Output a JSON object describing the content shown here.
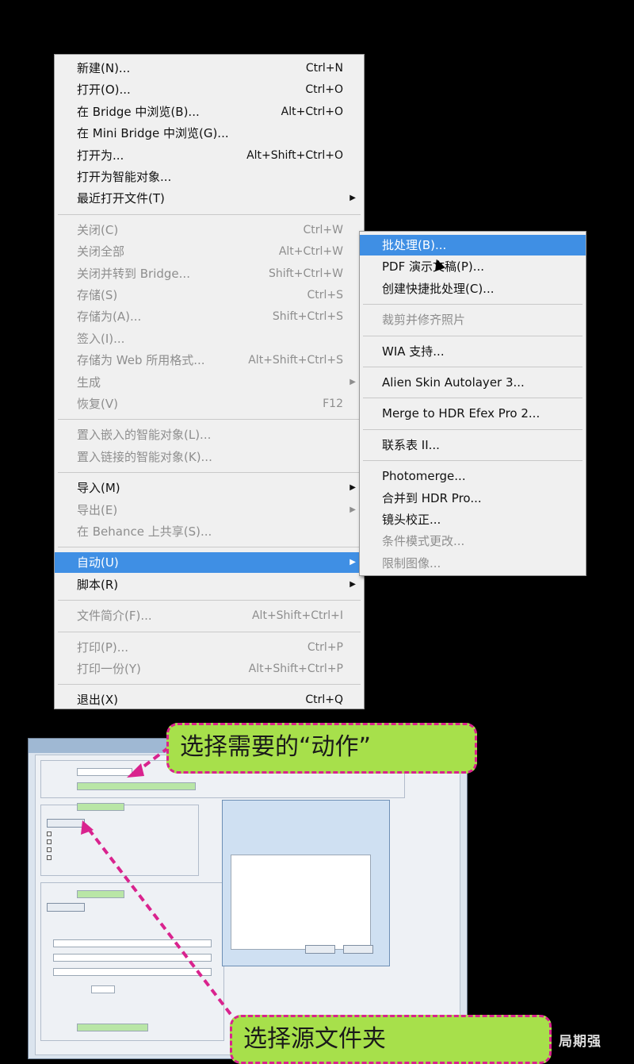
{
  "file_menu": {
    "groups": [
      [
        {
          "label": "新建(N)...",
          "shortcut": "Ctrl+N",
          "disabled": false
        },
        {
          "label": "打开(O)...",
          "shortcut": "Ctrl+O",
          "disabled": false
        },
        {
          "label": "在 Bridge 中浏览(B)...",
          "shortcut": "Alt+Ctrl+O",
          "disabled": false
        },
        {
          "label": "在 Mini Bridge 中浏览(G)...",
          "shortcut": "",
          "disabled": false
        },
        {
          "label": "打开为...",
          "shortcut": "Alt+Shift+Ctrl+O",
          "disabled": false
        },
        {
          "label": "打开为智能对象...",
          "shortcut": "",
          "disabled": false
        },
        {
          "label": "最近打开文件(T)",
          "shortcut": "",
          "disabled": false,
          "submenu": true
        }
      ],
      [
        {
          "label": "关闭(C)",
          "shortcut": "Ctrl+W",
          "disabled": true
        },
        {
          "label": "关闭全部",
          "shortcut": "Alt+Ctrl+W",
          "disabled": true
        },
        {
          "label": "关闭并转到 Bridge...",
          "shortcut": "Shift+Ctrl+W",
          "disabled": true
        },
        {
          "label": "存储(S)",
          "shortcut": "Ctrl+S",
          "disabled": true
        },
        {
          "label": "存储为(A)...",
          "shortcut": "Shift+Ctrl+S",
          "disabled": true
        },
        {
          "label": "签入(I)...",
          "shortcut": "",
          "disabled": true
        },
        {
          "label": "存储为 Web 所用格式...",
          "shortcut": "Alt+Shift+Ctrl+S",
          "disabled": true
        },
        {
          "label": "生成",
          "shortcut": "",
          "disabled": true,
          "submenu": true
        },
        {
          "label": "恢复(V)",
          "shortcut": "F12",
          "disabled": true
        }
      ],
      [
        {
          "label": "置入嵌入的智能对象(L)...",
          "shortcut": "",
          "disabled": true
        },
        {
          "label": "置入链接的智能对象(K)...",
          "shortcut": "",
          "disabled": true
        }
      ],
      [
        {
          "label": "导入(M)",
          "shortcut": "",
          "disabled": false,
          "submenu": true
        },
        {
          "label": "导出(E)",
          "shortcut": "",
          "disabled": true,
          "submenu": true
        },
        {
          "label": "在 Behance 上共享(S)...",
          "shortcut": "",
          "disabled": true
        }
      ],
      [
        {
          "label": "自动(U)",
          "shortcut": "",
          "disabled": false,
          "submenu": true,
          "highlighted": true
        },
        {
          "label": "脚本(R)",
          "shortcut": "",
          "disabled": false,
          "submenu": true
        }
      ],
      [
        {
          "label": "文件简介(F)...",
          "shortcut": "Alt+Shift+Ctrl+I",
          "disabled": true
        }
      ],
      [
        {
          "label": "打印(P)...",
          "shortcut": "Ctrl+P",
          "disabled": true
        },
        {
          "label": "打印一份(Y)",
          "shortcut": "Alt+Shift+Ctrl+P",
          "disabled": true
        }
      ],
      [
        {
          "label": "退出(X)",
          "shortcut": "Ctrl+Q",
          "disabled": false
        }
      ]
    ]
  },
  "automate_submenu": {
    "groups": [
      [
        {
          "label": "批处理(B)...",
          "disabled": false,
          "highlighted": true
        },
        {
          "label": "PDF 演示文稿(P)...",
          "disabled": false
        },
        {
          "label": "创建快捷批处理(C)...",
          "disabled": false
        }
      ],
      [
        {
          "label": "裁剪并修齐照片",
          "disabled": true
        }
      ],
      [
        {
          "label": "WIA 支持...",
          "disabled": false
        }
      ],
      [
        {
          "label": "Alien Skin Autolayer 3...",
          "disabled": false
        }
      ],
      [
        {
          "label": "Merge to HDR Efex Pro 2...",
          "disabled": false
        }
      ],
      [
        {
          "label": "联系表 II...",
          "disabled": false
        }
      ],
      [
        {
          "label": "Photomerge...",
          "disabled": false
        },
        {
          "label": "合并到 HDR Pro...",
          "disabled": false
        },
        {
          "label": "镜头校正...",
          "disabled": false
        },
        {
          "label": "条件模式更改...",
          "disabled": true
        },
        {
          "label": "限制图像...",
          "disabled": true
        }
      ]
    ]
  },
  "callouts": {
    "action": "选择需要的“动作”",
    "folder": "选择源文件夹"
  },
  "watermark": "局期强",
  "colors": {
    "highlight": "#3f8fe4",
    "callout_bg": "#a7e04b",
    "callout_border": "#d9238e"
  }
}
